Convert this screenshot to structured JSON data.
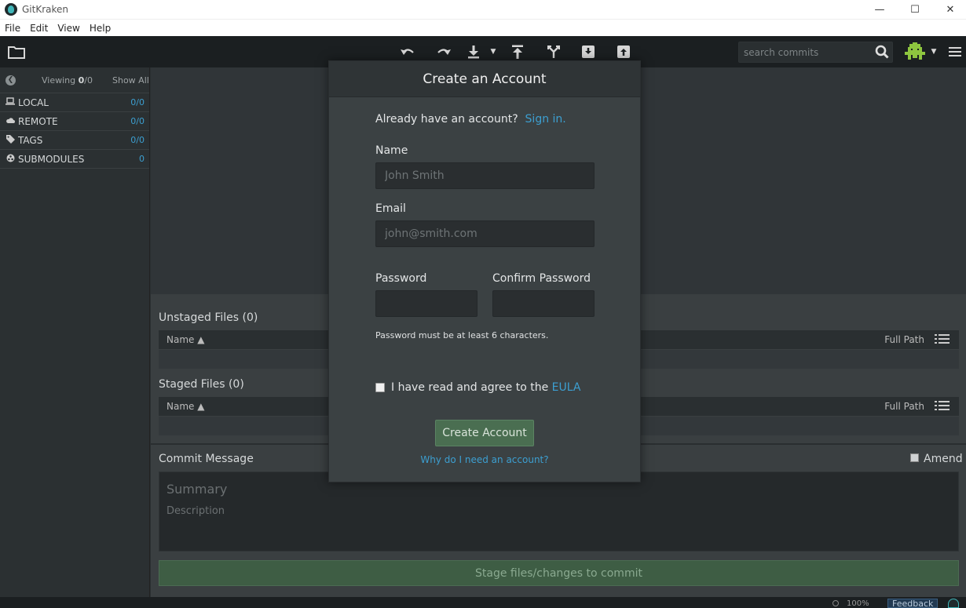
{
  "window": {
    "title": "GitKraken",
    "controls": {
      "minimize": "—",
      "maximize": "☐",
      "close": "✕"
    }
  },
  "menu": [
    "File",
    "Edit",
    "View",
    "Help"
  ],
  "toolbar": {
    "search_placeholder": "search commits",
    "icons": [
      "folder-icon",
      "undo-icon",
      "redo-icon",
      "pull-icon",
      "push-icon",
      "branch-icon",
      "stash-icon",
      "pop-icon",
      "search-icon",
      "avatar-icon",
      "hamburger-menu-icon"
    ]
  },
  "sidebar": {
    "viewing_label": "Viewing",
    "viewing_current": "0",
    "viewing_total": "/0",
    "show_all": "Show All",
    "items": [
      {
        "label": "LOCAL",
        "count": "0/0",
        "icon": "laptop-icon"
      },
      {
        "label": "REMOTE",
        "count": "0/0",
        "icon": "cloud-icon"
      },
      {
        "label": "TAGS",
        "count": "0/0",
        "icon": "tag-icon"
      },
      {
        "label": "SUBMODULES",
        "count": "0",
        "icon": "submodule-icon"
      }
    ]
  },
  "lower": {
    "unstaged_title": "Unstaged Files (0)",
    "staged_title": "Staged Files (0)",
    "name_col": "Name ▲",
    "path_col": "Full Path",
    "commit_title": "Commit Message",
    "amend": "Amend",
    "summary_placeholder": "Summary",
    "description_placeholder": "Description",
    "stage_button": "Stage files/changes to commit"
  },
  "status": {
    "zoom": "100%",
    "feedback": "Feedback"
  },
  "modal": {
    "title": "Create an Account",
    "have_account": "Already have an account?",
    "sign_in": "Sign in.",
    "name_label": "Name",
    "name_placeholder": "John Smith",
    "email_label": "Email",
    "email_placeholder": "john@smith.com",
    "password_label": "Password",
    "confirm_label": "Confirm Password",
    "password_hint": "Password must be at least 6 characters.",
    "eula_text": "I have read and agree to the",
    "eula_link": "EULA",
    "create_button": "Create Account",
    "why_link": "Why do I need an account?"
  },
  "colors": {
    "accent": "#3c9fd1",
    "primary_button": "#4a6e51",
    "toolbar_bg": "#1b1f21",
    "panel_bg": "#3b4143"
  }
}
